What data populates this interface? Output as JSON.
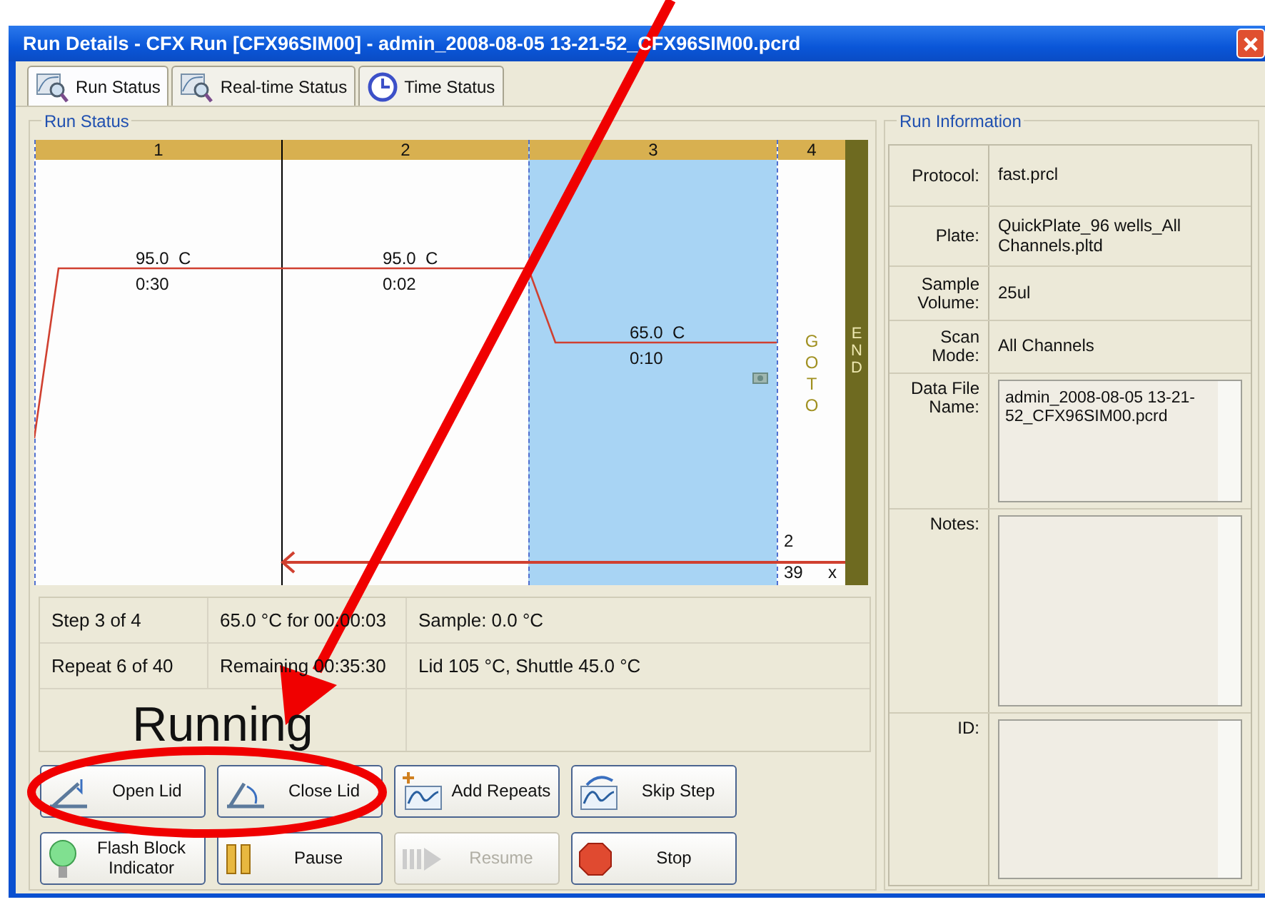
{
  "window": {
    "title": "Run Details - CFX Run [CFX96SIM00] - admin_2008-08-05 13-21-52_CFX96SIM00.pcrd"
  },
  "tabs": [
    {
      "label": "Run Status",
      "selected": true
    },
    {
      "label": "Real-time Status",
      "selected": false
    },
    {
      "label": "Time Status",
      "selected": false
    }
  ],
  "run_status": {
    "title": "Run Status",
    "steps": [
      {
        "kind": "temp",
        "number": "1",
        "temperature": "95.0  C",
        "time": "0:30",
        "current": false
      },
      {
        "kind": "temp",
        "number": "2",
        "temperature": "95.0  C",
        "time": "0:02",
        "current": false
      },
      {
        "kind": "temp",
        "number": "3",
        "temperature": "65.0  C",
        "time": "0:10",
        "current": true
      },
      {
        "kind": "goto",
        "number": "4",
        "label": "GOTO",
        "target": "2",
        "repeats": "39",
        "times": "x"
      }
    ],
    "end_label": "END"
  },
  "status_rows": [
    [
      "Step  3  of  4",
      "65.0 °C  for  00:00:03",
      "Sample: 0.0 °C"
    ],
    [
      "Repeat  6  of  40",
      "Remaining 00:35:30",
      "Lid 105 °C, Shuttle 45.0 °C"
    ]
  ],
  "state": "Running",
  "buttons": [
    {
      "label": "Open Lid",
      "disabled": false
    },
    {
      "label": "Close Lid",
      "disabled": false
    },
    {
      "label": "Add Repeats",
      "disabled": false
    },
    {
      "label": "Skip Step",
      "disabled": false
    },
    {
      "label": "Flash Block Indicator",
      "disabled": false
    },
    {
      "label": "Pause",
      "disabled": false
    },
    {
      "label": "Resume",
      "disabled": true
    },
    {
      "label": "Stop",
      "disabled": false
    }
  ],
  "run_information": {
    "title": "Run Information",
    "fields": [
      {
        "kind": "text",
        "label": "Protocol:",
        "value": "fast.prcl"
      },
      {
        "kind": "text",
        "label": "Plate:",
        "value": "QuickPlate_96 wells_All Channels.pltd"
      },
      {
        "kind": "text",
        "label": "Sample Volume:",
        "value": "25ul"
      },
      {
        "kind": "text",
        "label": "Scan Mode:",
        "value": "All Channels"
      },
      {
        "kind": "multiline",
        "label": "Data File Name:",
        "value": "admin_2008-08-05 13-21-52_CFX96SIM00.pcrd"
      },
      {
        "kind": "multiline",
        "label": "Notes:"
      },
      {
        "kind": "multiline",
        "label": "ID:"
      }
    ]
  }
}
